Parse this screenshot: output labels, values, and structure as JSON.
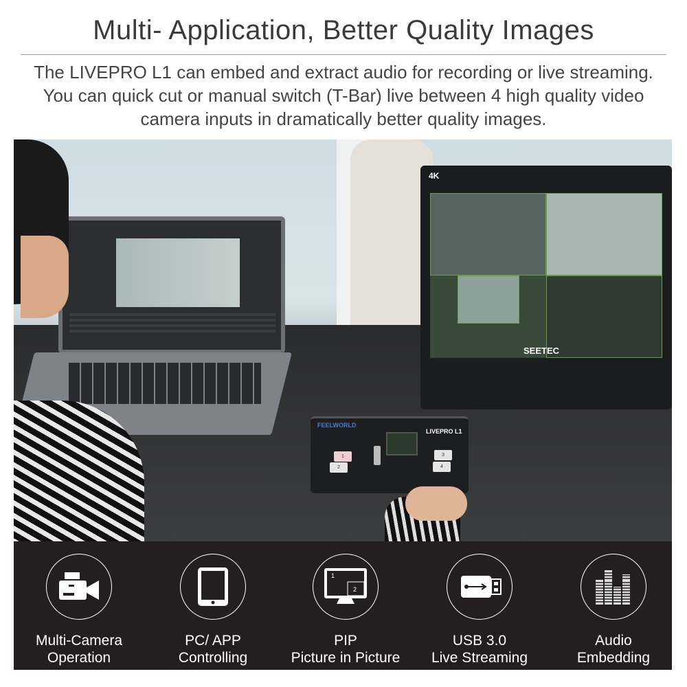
{
  "header": {
    "title": "Multi- Application, Better Quality Images",
    "description": "The LIVEPRO L1 can embed and extract audio for recording or live streaming. You can quick cut or manual switch (T-Bar) live between 4 high quality video camera inputs in dramatically better quality images."
  },
  "photo": {
    "monitor_badge": "4K",
    "monitor_brand": "SEETEC",
    "device_brand": "FEELWORLD",
    "device_model": "LIVEPRO L1",
    "device_buttons": [
      "1",
      "2",
      "3",
      "4"
    ]
  },
  "features": [
    {
      "icon": "video-camera-icon",
      "line1": "Multi-Camera",
      "line2": "Operation"
    },
    {
      "icon": "tablet-icon",
      "line1": "PC/ APP",
      "line2": "Controlling"
    },
    {
      "icon": "pip-monitor-icon",
      "line1": "PIP",
      "line2": "Picture in Picture",
      "pip_labels": [
        "1",
        "2"
      ]
    },
    {
      "icon": "usb-drive-icon",
      "line1": "USB 3.0",
      "line2": "Live Streaming"
    },
    {
      "icon": "audio-equalizer-icon",
      "line1": "Audio",
      "line2": "Embedding"
    }
  ]
}
